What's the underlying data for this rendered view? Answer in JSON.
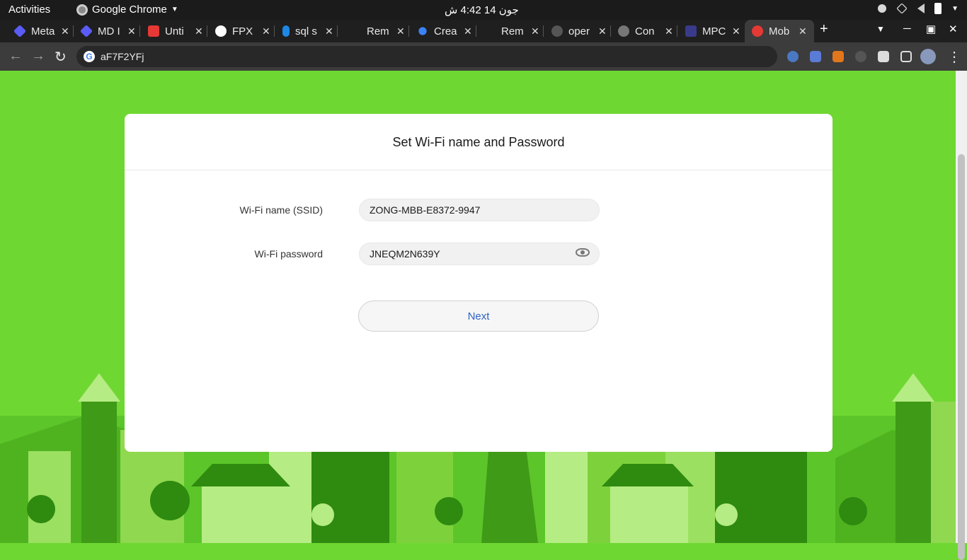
{
  "system_bar": {
    "activities": "Activities",
    "app_name": "Google Chrome",
    "clock": "جون 14  4:42 ش"
  },
  "tabs": [
    {
      "label": "Meta",
      "favicon_color": "#5b5bf5"
    },
    {
      "label": "MD I",
      "favicon_color": "#5b5bf5"
    },
    {
      "label": "Unti",
      "favicon_color": "#e53935"
    },
    {
      "label": "FPX",
      "favicon_color": "#4285f4"
    },
    {
      "label": "sql s",
      "favicon_color": "#1e88e5"
    },
    {
      "label": "Rem",
      "favicon_color": "#1f1f1f"
    },
    {
      "label": "Crea",
      "favicon_color": "#3b82f6"
    },
    {
      "label": "Rem",
      "favicon_color": "#1f1f1f"
    },
    {
      "label": "oper",
      "favicon_color": "#555555"
    },
    {
      "label": "Con",
      "favicon_color": "#777777"
    },
    {
      "label": "MPC",
      "favicon_color": "#3a3a8c"
    },
    {
      "label": "Mob",
      "favicon_color": "#e53935",
      "active": true
    }
  ],
  "address_bar": {
    "url": "aF7F2YFj"
  },
  "form": {
    "title": "Set Wi-Fi name and Password",
    "ssid_label": "Wi-Fi name (SSID)",
    "ssid_value": "ZONG-MBB-E8372-9947",
    "password_label": "Wi-Fi password",
    "password_value": "JNEQM2N639Y",
    "next_label": "Next"
  },
  "colors": {
    "background": "#6fd732",
    "accent_text": "#2d62c4"
  }
}
